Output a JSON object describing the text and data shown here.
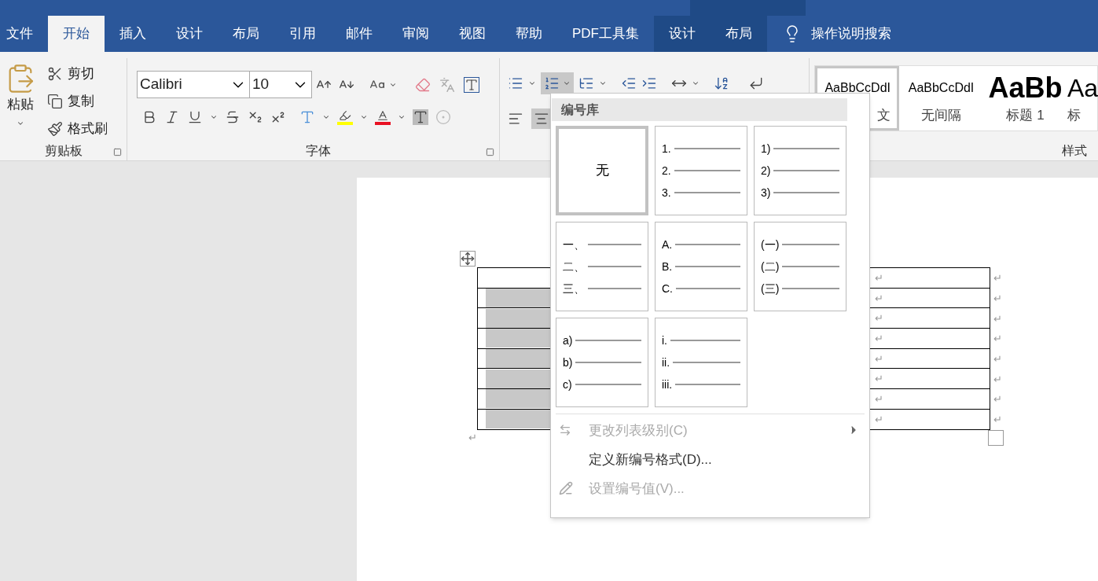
{
  "tabs": [
    {
      "label": "文件",
      "selected": false,
      "kind": "normal"
    },
    {
      "label": "开始",
      "selected": true,
      "kind": "normal"
    },
    {
      "label": "插入",
      "selected": false,
      "kind": "normal"
    },
    {
      "label": "设计",
      "selected": false,
      "kind": "normal"
    },
    {
      "label": "布局",
      "selected": false,
      "kind": "normal"
    },
    {
      "label": "引用",
      "selected": false,
      "kind": "normal"
    },
    {
      "label": "邮件",
      "selected": false,
      "kind": "normal"
    },
    {
      "label": "审阅",
      "selected": false,
      "kind": "normal"
    },
    {
      "label": "视图",
      "selected": false,
      "kind": "normal"
    },
    {
      "label": "帮助",
      "selected": false,
      "kind": "normal"
    },
    {
      "label": "PDF工具集",
      "selected": false,
      "kind": "normal"
    },
    {
      "label": "设计",
      "selected": false,
      "kind": "context"
    },
    {
      "label": "布局",
      "selected": false,
      "kind": "context"
    }
  ],
  "tell_me": "操作说明搜索",
  "clipboard": {
    "paste": "粘贴",
    "items": [
      {
        "kind": "cut",
        "label": "剪切"
      },
      {
        "kind": "copy",
        "label": "复制"
      },
      {
        "kind": "painter",
        "label": "格式刷"
      }
    ],
    "label": "剪贴板"
  },
  "font": {
    "name": "Calibri",
    "size": "10",
    "label": "字体"
  },
  "styles": {
    "items": [
      {
        "sample": "AaBbCcDdI",
        "label": "文",
        "selected": true
      },
      {
        "sample": "AaBbCcDdI",
        "label": "无间隔",
        "selected": false
      },
      {
        "sample": "AaBb",
        "label": "标题 1",
        "selected": false
      },
      {
        "sample": "Aa",
        "label": "标",
        "selected": false
      }
    ],
    "label": "样式"
  },
  "numbering_menu": {
    "header": "编号库",
    "tiles": [
      {
        "kind": "none",
        "text": "无",
        "selected": true
      },
      {
        "kind": "list",
        "lines": [
          "1.",
          "2.",
          "3."
        ],
        "selected": false
      },
      {
        "kind": "list",
        "lines": [
          "1)",
          "2)",
          "3)"
        ],
        "selected": false
      },
      {
        "kind": "list",
        "lines": [
          "一、",
          "二、",
          "三、"
        ],
        "selected": false
      },
      {
        "kind": "list",
        "lines": [
          "A.",
          "B.",
          "C."
        ],
        "selected": false
      },
      {
        "kind": "list",
        "lines": [
          "(一)",
          "(二)",
          "(三)"
        ],
        "selected": false
      },
      {
        "kind": "list",
        "lines": [
          "a)",
          "b)",
          "c)"
        ],
        "selected": false
      },
      {
        "kind": "list",
        "lines": [
          "i.",
          "ii.",
          "iii."
        ],
        "selected": false
      }
    ],
    "items": [
      {
        "label": "更改列表级别(C)",
        "disabled": true,
        "submenu": true
      },
      {
        "label": "定义新编号格式(D)...",
        "disabled": false,
        "submenu": false
      },
      {
        "label": "设置编号值(V)...",
        "disabled": true,
        "submenu": false
      }
    ]
  },
  "document": {
    "rows": [
      {
        "shaded": false,
        "cell_mark": "↵",
        "row_mark": "↵"
      },
      {
        "shaded": true,
        "cell_mark": "↵",
        "row_mark": "↵"
      },
      {
        "shaded": true,
        "cell_mark": "↵",
        "row_mark": "↵"
      },
      {
        "shaded": true,
        "cell_mark": "↵",
        "row_mark": "↵"
      },
      {
        "shaded": true,
        "cell_mark": "↵",
        "row_mark": "↵"
      },
      {
        "shaded": true,
        "cell_mark": "↵",
        "row_mark": "↵"
      },
      {
        "shaded": true,
        "cell_mark": "↵",
        "row_mark": "↵"
      },
      {
        "shaded": true,
        "cell_mark": "↵",
        "row_mark": "↵"
      }
    ],
    "paragraph_mark": "↵"
  }
}
